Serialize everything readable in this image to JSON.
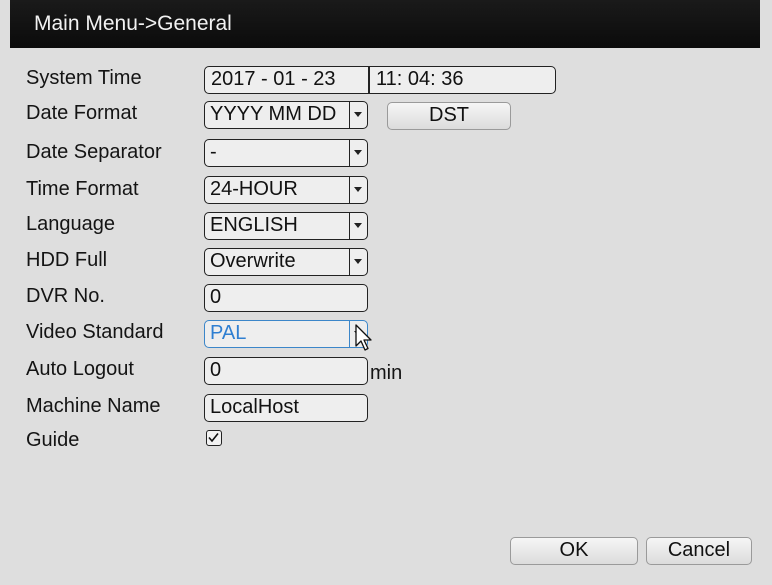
{
  "window": {
    "title": "Main Menu->General"
  },
  "fields": {
    "system_time": {
      "label": "System Time",
      "date": "2017 - 01 - 23",
      "time": "11: 04: 36"
    },
    "date_format": {
      "label": "Date Format",
      "value": "YYYY MM DD",
      "dst_button": "DST"
    },
    "date_separator": {
      "label": "Date Separator",
      "value": "-"
    },
    "time_format": {
      "label": "Time Format",
      "value": "24-HOUR"
    },
    "language": {
      "label": "Language",
      "value": "ENGLISH"
    },
    "hdd_full": {
      "label": "HDD Full",
      "value": "Overwrite"
    },
    "dvr_no": {
      "label": "DVR No.",
      "value": "0"
    },
    "video_standard": {
      "label": "Video Standard",
      "value": "PAL"
    },
    "auto_logout": {
      "label": "Auto Logout",
      "value": "0",
      "unit": "min"
    },
    "machine_name": {
      "label": "Machine Name",
      "value": "LocalHost"
    },
    "guide": {
      "label": "Guide",
      "checked": true
    }
  },
  "buttons": {
    "ok": "OK",
    "cancel": "Cancel"
  },
  "colors": {
    "titlebar": "#111111",
    "panel": "#e3e3e3",
    "focus": "#3b86c9"
  },
  "icons": {
    "dropdown": "chevron-down-icon",
    "cursor": "mouse-pointer-icon",
    "check": "check-icon"
  }
}
